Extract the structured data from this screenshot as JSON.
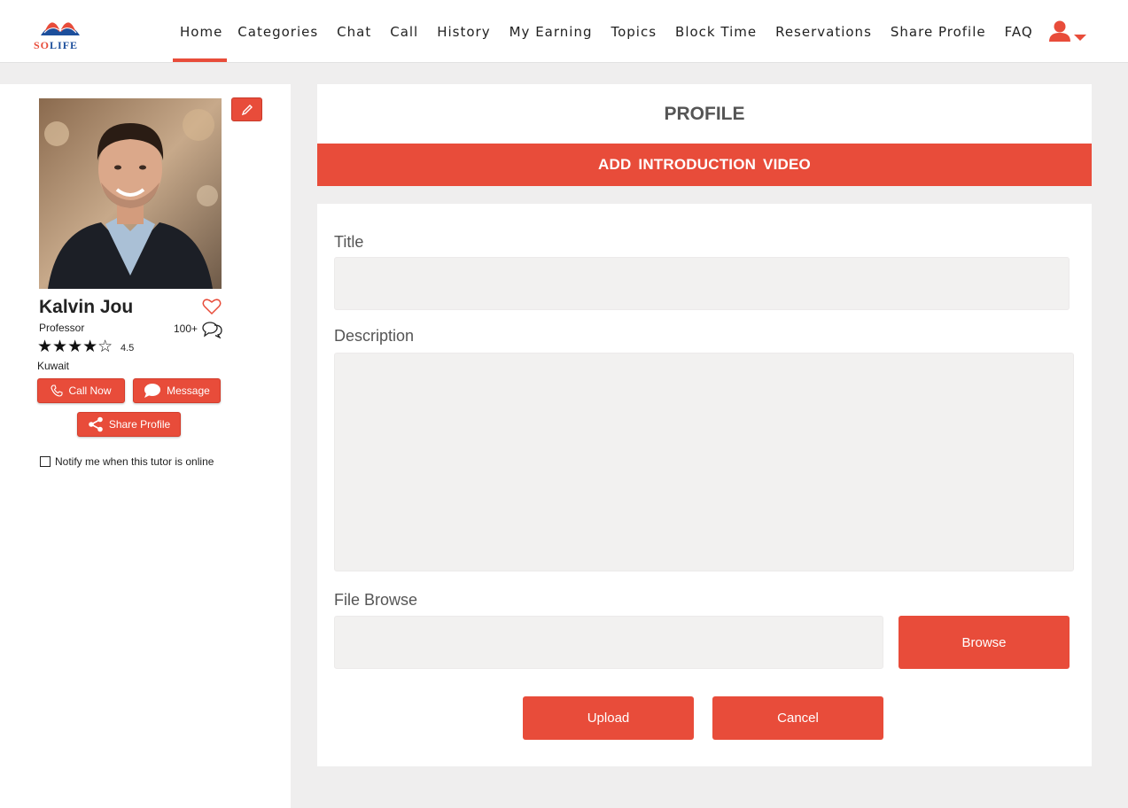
{
  "logo": {
    "text_a": "SO",
    "text_b": "LIFE"
  },
  "nav": {
    "items": [
      {
        "label": "Home",
        "active": true
      },
      {
        "label": "Categories"
      },
      {
        "label": "Chat"
      },
      {
        "label": "Call"
      },
      {
        "label": "History"
      },
      {
        "label": "My Earning"
      },
      {
        "label": "Topics"
      },
      {
        "label": "Block Time"
      },
      {
        "label": "Reservations"
      },
      {
        "label": "Share Profile"
      },
      {
        "label": "FAQ"
      }
    ],
    "user_icon": "user-icon"
  },
  "tutor": {
    "name": "Kalvin Jou",
    "title": "Professor",
    "chat_count": "100+",
    "stars": "★★★★☆",
    "rating": "4.5",
    "country": "Kuwait",
    "call_label": "Call Now",
    "message_label": "Message",
    "share_label": "Share Profile",
    "notify_label": "Notify me when this tutor is online"
  },
  "profile": {
    "heading": "PROFILE",
    "intro_bar": "ADD  INTRODUCTION VIDEO"
  },
  "form": {
    "title_label": "Title",
    "title_value": "",
    "description_label": "Description",
    "description_value": "",
    "file_label": "File Browse",
    "file_value": "",
    "browse_label": "Browse",
    "upload_label": "Upload",
    "cancel_label": "Cancel"
  },
  "colors": {
    "accent": "#e84c3a",
    "brand_blue": "#1d4f9c",
    "field_bg": "#f2f1f0",
    "page_bg": "#efeeee"
  }
}
